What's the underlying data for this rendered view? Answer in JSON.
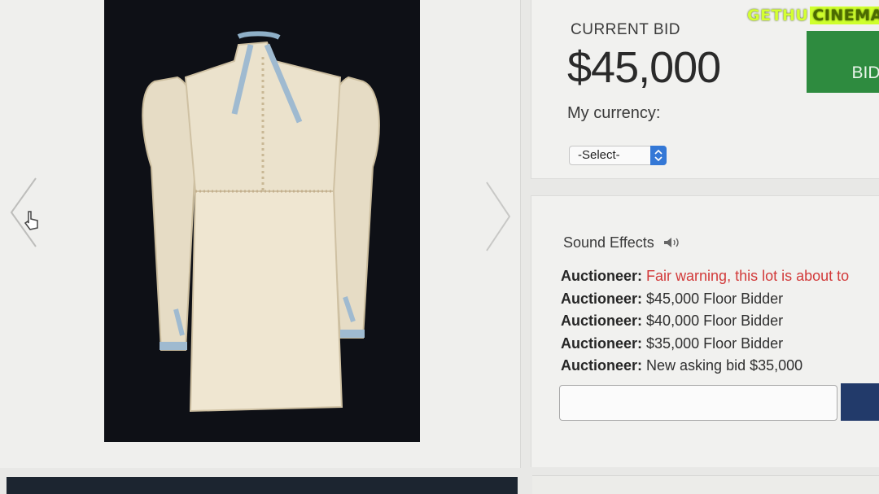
{
  "auction": {
    "current_bid_label": "CURRENT BID",
    "current_bid_value": "$45,000",
    "bid_button_label": "BID",
    "currency_label": "My currency:",
    "currency_selected": "-Select-"
  },
  "feed": {
    "sound_effects_label": "Sound Effects",
    "lines": [
      {
        "speaker": "Auctioneer:",
        "text": "Fair warning, this lot is about to",
        "warning": true
      },
      {
        "speaker": "Auctioneer:",
        "text": "$45,000 Floor Bidder",
        "warning": false
      },
      {
        "speaker": "Auctioneer:",
        "text": "$40,000 Floor Bidder",
        "warning": false
      },
      {
        "speaker": "Auctioneer:",
        "text": "$35,000 Floor Bidder",
        "warning": false
      },
      {
        "speaker": "Auctioneer:",
        "text": "New asking bid $35,000",
        "warning": false
      }
    ]
  },
  "watermark": {
    "part1": "GETHU",
    "part2": "CINEMA"
  },
  "colors": {
    "bid_button": "#2e8b3f",
    "warning_text": "#d23a3a",
    "submit_button": "#223a6a",
    "photo_background": "#0e1016"
  },
  "icons": {
    "gallery_prev": "chevron-left-icon",
    "gallery_next": "chevron-right-icon",
    "cursor": "hand-pointer-icon",
    "speaker": "speaker-icon"
  }
}
